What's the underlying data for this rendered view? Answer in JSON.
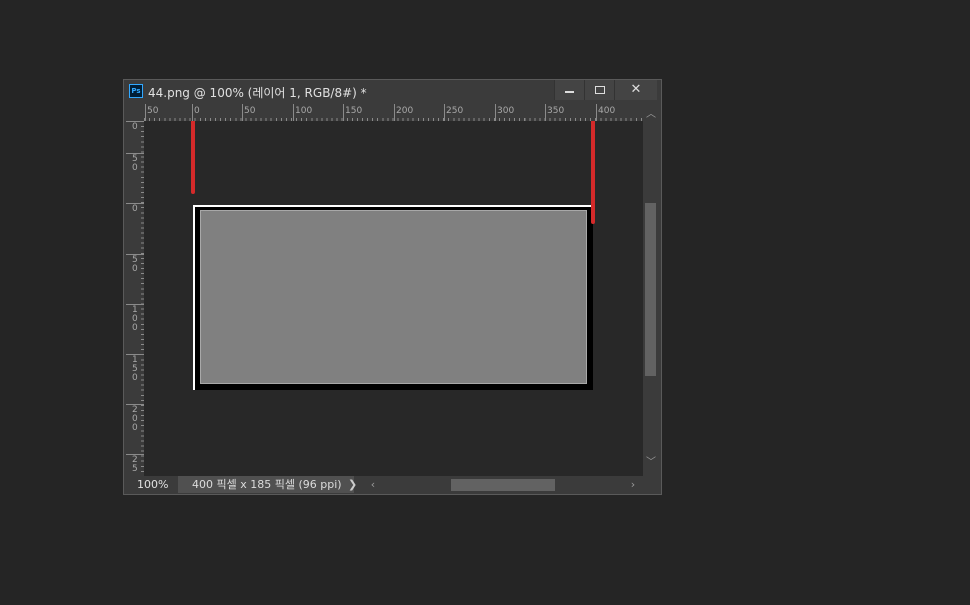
{
  "window": {
    "title": "44.png @ 100% (레이어 1, RGB/8#) *",
    "app_icon_label": "Ps",
    "buttons": {
      "minimize_icon": "minimize-icon",
      "maximize_icon": "maximize-icon",
      "close_label": "✕"
    }
  },
  "ruler": {
    "horizontal_labels": [
      "50",
      "0",
      "50",
      "100",
      "150",
      "200",
      "250",
      "300",
      "350",
      "400"
    ],
    "vertical_labels": [
      "0",
      "5\n0",
      "0",
      "5\n0",
      "1\n0\n0",
      "1\n5\n0",
      "2\n0\n0",
      "2\n5"
    ]
  },
  "status": {
    "zoom": "100%",
    "doc_info": "400 픽셀 x 185 픽셀 (96 ppi)",
    "arrow": "❯"
  },
  "scroll": {
    "up": "︿",
    "down": "﹀",
    "left": "‹",
    "right": "›"
  },
  "colors": {
    "background": "#252525",
    "canvas": "#282828",
    "gray_shape": "#808080",
    "marker": "#d42a2a"
  }
}
